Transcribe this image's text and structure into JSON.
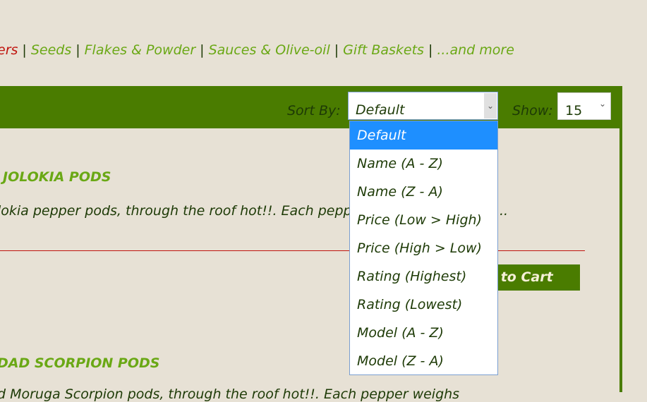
{
  "nav": {
    "items": [
      {
        "label": "ers",
        "active": true
      },
      {
        "label": "Seeds"
      },
      {
        "label": "Flakes & Powder"
      },
      {
        "label": "Sauces & Olive-oil"
      },
      {
        "label": "Gift Baskets"
      },
      {
        "label": "...and more"
      }
    ],
    "separator": "|"
  },
  "toolbar": {
    "sort_label": "Sort By:",
    "sort_value": "Default",
    "show_label": "Show:",
    "show_value": "15"
  },
  "sort_options": [
    "Default",
    "Name (A - Z)",
    "Name (Z - A)",
    "Price (Low > High)",
    "Price (High > Low)",
    "Rating (Highest)",
    "Rating (Lowest)",
    "Model (A - Z)",
    "Model (Z - A)"
  ],
  "sort_selected_index": 0,
  "products": [
    {
      "title": "JOLOKIA PODS",
      "description": "lokia pepper pods, through the roof hot!!. Each pepp",
      "ellipsis": "..",
      "cart_label": "ld to Cart"
    },
    {
      "title": "DAD SCORPION PODS",
      "description": "d Moruga Scorpion pods, through the roof hot!!. Each pepper weighs"
    }
  ],
  "colors": {
    "background": "#e7e1d5",
    "toolbar": "#4a7c00",
    "link": "#6aa815",
    "active_link": "#c0140e",
    "text": "#1d3a06",
    "selected_option": "#1e8fff"
  }
}
